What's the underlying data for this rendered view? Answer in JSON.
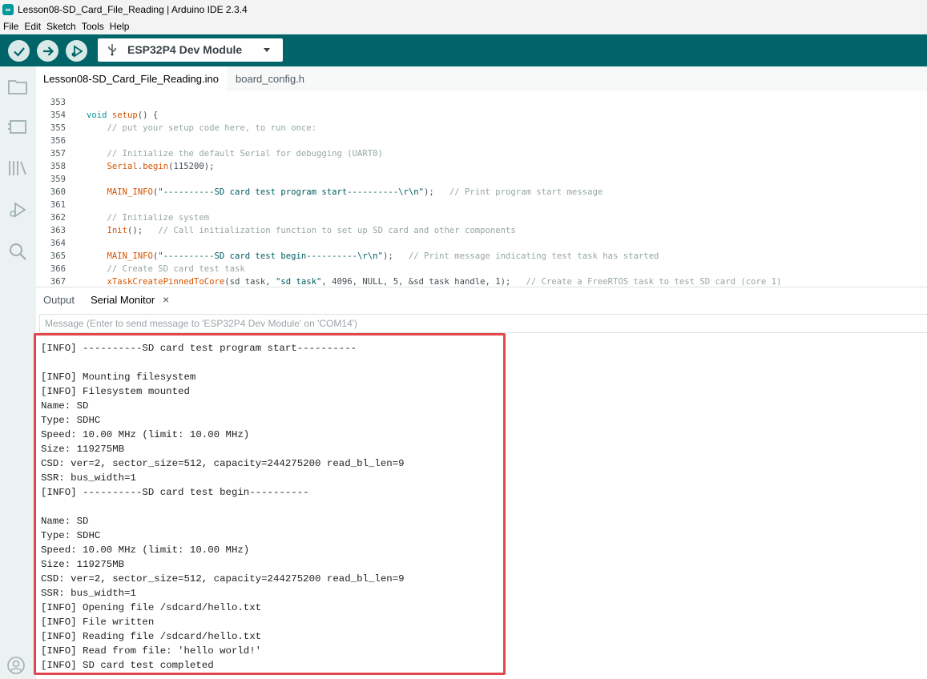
{
  "window": {
    "title": "Lesson08-SD_Card_File_Reading | Arduino IDE 2.3.4"
  },
  "menu": [
    "File",
    "Edit",
    "Sketch",
    "Tools",
    "Help"
  ],
  "toolbar": {
    "verify_icon": "check-icon",
    "upload_icon": "arrow-right-icon",
    "debug_icon": "debug-icon",
    "board": "ESP32P4 Dev Module"
  },
  "sidebar": [
    "folder-icon",
    "board-manager-icon",
    "library-icon",
    "debug-icon",
    "search-icon",
    "account-icon"
  ],
  "tabs": [
    {
      "label": "Lesson08-SD_Card_File_Reading.ino",
      "active": true
    },
    {
      "label": "board_config.h",
      "active": false
    }
  ],
  "editor": {
    "lines": [
      {
        "num": "353",
        "code": ""
      },
      {
        "num": "354",
        "code": "void setup() {"
      },
      {
        "num": "355",
        "code": "    // put your setup code here, to run once:"
      },
      {
        "num": "356",
        "code": ""
      },
      {
        "num": "357",
        "code": "    // Initialize the default Serial for debugging (UART0)"
      },
      {
        "num": "358",
        "code": "    Serial.begin(115200);"
      },
      {
        "num": "359",
        "code": ""
      },
      {
        "num": "360",
        "code": "    MAIN_INFO(\"----------SD card test program start----------\\r\\n\");   // Print program start message"
      },
      {
        "num": "361",
        "code": ""
      },
      {
        "num": "362",
        "code": "    // Initialize system"
      },
      {
        "num": "363",
        "code": "    Init();   // Call initialization function to set up SD card and other components"
      },
      {
        "num": "364",
        "code": ""
      },
      {
        "num": "365",
        "code": "    MAIN_INFO(\"----------SD card test begin----------\\r\\n\");   // Print message indicating test task has started"
      },
      {
        "num": "366",
        "code": "    // Create SD card test task"
      },
      {
        "num": "367",
        "code": "    xTaskCreatePinnedToCore(sd_task, \"sd_task\", 4096, NULL, 5, &sd_task_handle, 1);   // Create a FreeRTOS task to test SD card (core 1)"
      }
    ]
  },
  "panel": {
    "tab_output": "Output",
    "tab_serial": "Serial Monitor",
    "close": "×",
    "message_placeholder": "Message (Enter to send message to 'ESP32P4 Dev Module' on 'COM14')"
  },
  "serial": [
    "[INFO] ----------SD card test program start----------",
    "",
    "[INFO] Mounting filesystem",
    "[INFO] Filesystem mounted",
    "Name: SD",
    "Type: SDHC",
    "Speed: 10.00 MHz (limit: 10.00 MHz)",
    "Size: 119275MB",
    "CSD: ver=2, sector_size=512, capacity=244275200 read_bl_len=9",
    "SSR: bus_width=1",
    "[INFO] ----------SD card test begin----------",
    "",
    "Name: SD",
    "Type: SDHC",
    "Speed: 10.00 MHz (limit: 10.00 MHz)",
    "Size: 119275MB",
    "CSD: ver=2, sector_size=512, capacity=244275200 read_bl_len=9",
    "SSR: bus_width=1",
    "[INFO] Opening file /sdcard/hello.txt",
    "[INFO] File written",
    "[INFO] Reading file /sdcard/hello.txt",
    "[INFO] Read from file: 'hello world!'",
    "[INFO] SD card test completed"
  ],
  "colors": {
    "toolbar": "#006468",
    "accent": "#00979d",
    "highlight": "#e2474d"
  }
}
